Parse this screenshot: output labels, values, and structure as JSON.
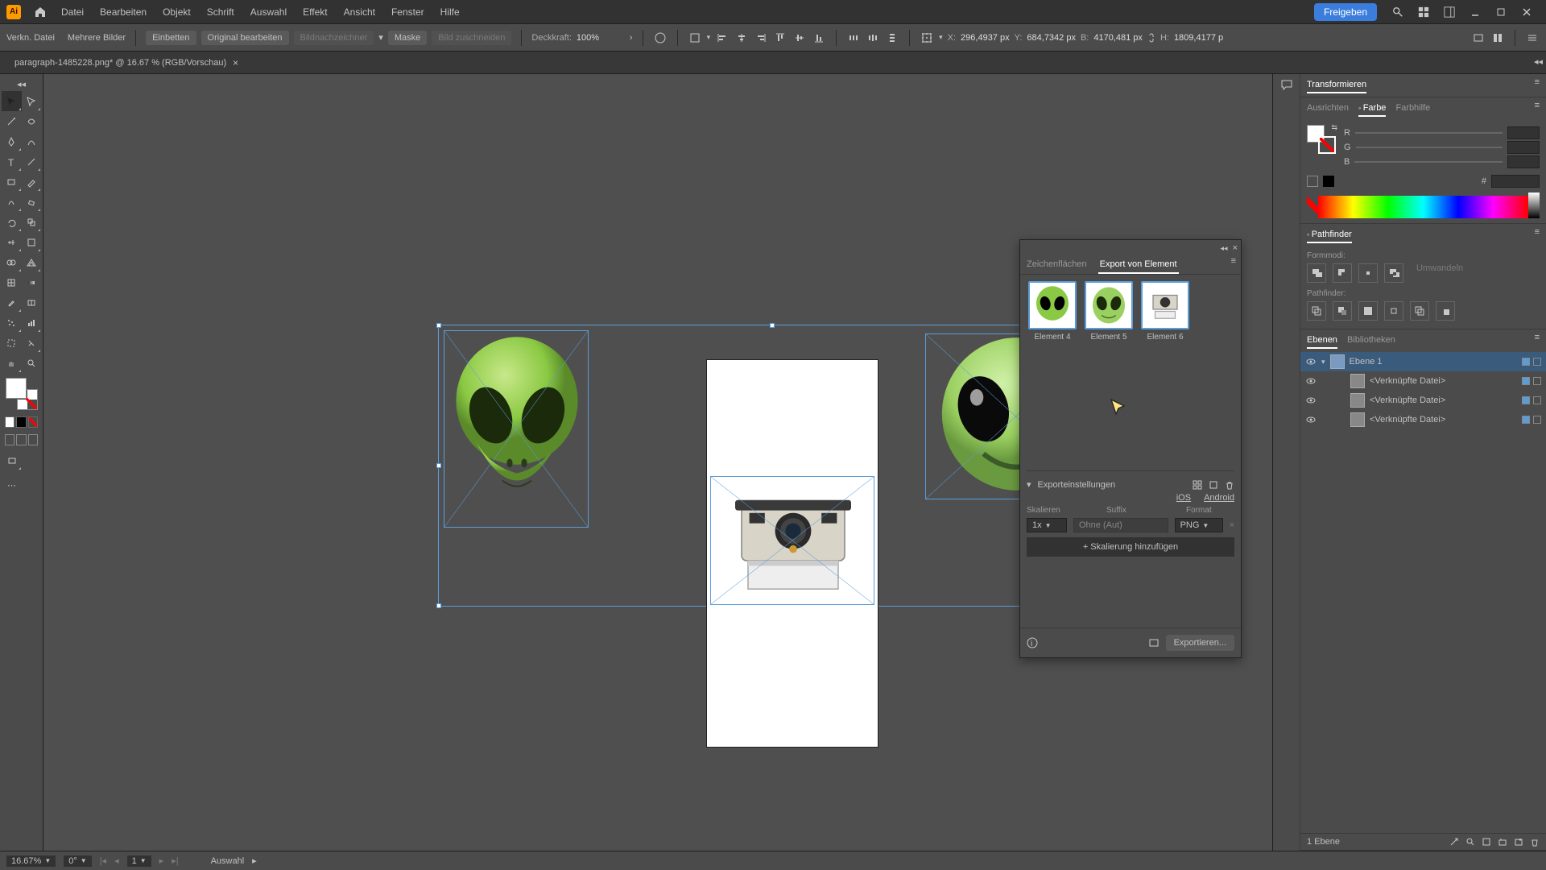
{
  "menu": {
    "items": [
      "Datei",
      "Bearbeiten",
      "Objekt",
      "Schrift",
      "Auswahl",
      "Effekt",
      "Ansicht",
      "Fenster",
      "Hilfe"
    ],
    "share": "Freigeben"
  },
  "control": {
    "linked": "Verkn. Datei",
    "multiple": "Mehrere Bilder",
    "embed": "Einbetten",
    "edit": "Original bearbeiten",
    "trace": "Bildnachzeichner",
    "mask": "Maske",
    "crop": "Bild zuschneiden",
    "opacity_label": "Deckkraft:",
    "opacity_value": "100%",
    "x_label": "X:",
    "x_val": "296,4937 px",
    "y_label": "Y:",
    "y_val": "684,7342 px",
    "w_label": "B:",
    "w_val": "4170,481 px",
    "h_label": "H:",
    "h_val": "1809,4177 p"
  },
  "tab": {
    "title": "paragraph-1485228.png* @ 16.67 % (RGB/Vorschau)"
  },
  "export_panel": {
    "tab1": "Zeichenflächen",
    "tab2": "Export von Element",
    "asset1": "Element 4",
    "asset2": "Element 5",
    "asset3": "Element 6",
    "settings_label": "Exporteinstellungen",
    "ios": "iOS",
    "android": "Android",
    "col_scale": "Skalieren",
    "col_suffix": "Suffix",
    "col_format": "Format",
    "scale_val": "1x",
    "suffix_val": "Ohne (Aut)",
    "format_val": "PNG",
    "add_scale": "+ Skalierung hinzufügen",
    "export_btn": "Exportieren..."
  },
  "right": {
    "transform": "Transformieren",
    "align": "Ausrichten",
    "color": "Farbe",
    "guides": "Farbhilfe",
    "r": "R",
    "g": "G",
    "b": "B",
    "hash": "#",
    "pathfinder": "Pathfinder",
    "formmodi": "Formmodi:",
    "pf_label": "Pathfinder:",
    "expand": "Umwandeln",
    "layers": "Ebenen",
    "libs": "Bibliotheken",
    "layer1": "Ebene 1",
    "linked": "<Verknüpfte Datei>",
    "layer_count": "1 Ebene"
  },
  "status": {
    "zoom": "16.67%",
    "rotate": "0°",
    "artboard_num": "1",
    "tool": "Auswahl"
  }
}
